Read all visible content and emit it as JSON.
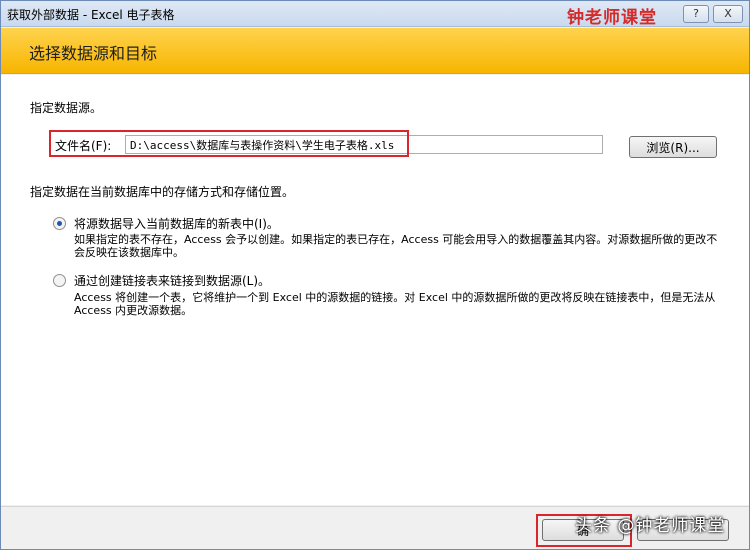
{
  "window": {
    "title": "获取外部数据 - Excel 电子表格",
    "help_label": "?",
    "close_label": "X"
  },
  "watermark_top": "钟老师课堂",
  "banner": {
    "title": "选择数据源和目标"
  },
  "source": {
    "label": "指定数据源。",
    "file_label": "文件名(F):",
    "file_value": "D:\\access\\数据库与表操作资料\\学生电子表格.xls",
    "browse_label": "浏览(R)..."
  },
  "storage": {
    "label": "指定数据在当前数据库中的存储方式和存储位置。",
    "options": [
      {
        "label": "将源数据导入当前数据库的新表中(I)。",
        "description": "如果指定的表不存在，Access 会予以创建。如果指定的表已存在，Access 可能会用导入的数据覆盖其内容。对源数据所做的更改不会反映在该数据库中。",
        "selected": true
      },
      {
        "label": "通过创建链接表来链接到数据源(L)。",
        "description": "Access 将创建一个表，它将维护一个到 Excel 中的源数据的链接。对 Excel 中的源数据所做的更改将反映在链接表中，但是无法从 Access 内更改源数据。",
        "selected": false
      }
    ]
  },
  "footer": {
    "ok_label": "确",
    "watermark": "头条 @钟老师课堂"
  },
  "colors": {
    "banner": "#f7b500",
    "highlight": "#d9262c",
    "watermark_red": "#d42b2b"
  }
}
